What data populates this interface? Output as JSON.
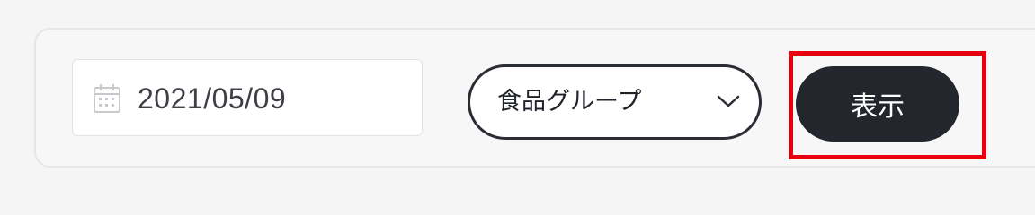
{
  "filter_bar": {
    "date_field": {
      "value": "2021/05/09",
      "icon": "calendar-icon"
    },
    "group_select": {
      "selected": "食品グループ",
      "icon": "chevron-down-icon"
    },
    "show_button": {
      "label": "表示"
    },
    "highlight_color": "#e8000f",
    "button_color": "#23262d"
  }
}
